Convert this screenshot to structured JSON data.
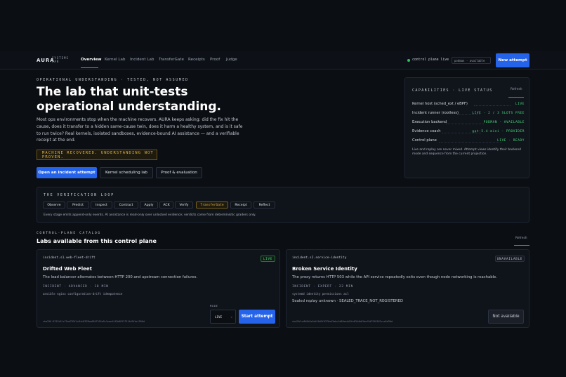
{
  "brand": {
    "name": "AURA",
    "sub": "SYSTEMS LAB"
  },
  "nav": {
    "items": [
      "Overview",
      "Kernel Lab",
      "Incident Lab",
      "TransferGate",
      "Receipts",
      "Proof",
      "Judge"
    ],
    "active": "Overview"
  },
  "status": {
    "text": "control plane live",
    "pill": "podman · available"
  },
  "header_button": "New attempt",
  "hero": {
    "eyebrow": "OPERATIONAL UNDERSTANDING · TESTED, NOT ASSUMED",
    "title": "The lab that unit-tests operational understanding.",
    "body": "Most ops environments stop when the machine recovers. AURA keeps asking: did the fix hit the cause, does it transfer to a hidden same-cause twin, does it harm a healthy system, and is it safe to run twice? Real kernels, isolated sandboxes, evidence-bound AI assistance — and a verifiable receipt at the end.",
    "banner": "MACHINE RECOVERED. UNDERSTANDING NOT PROVEN.",
    "buttons": [
      "Open an incident attempt",
      "Kernel scheduling lab",
      "Proof & evaluation"
    ]
  },
  "capabilities": {
    "title": "CAPABILITIES · LIVE STATUS",
    "refresh": "Refresh",
    "rows": [
      {
        "label": "Kernel host (sched_ext / eBPF)",
        "value": "LIVE"
      },
      {
        "label": "Incident runner (rootless)",
        "value": "LIVE · 2 / 3 SLOTS FREE"
      },
      {
        "label": "Execution backend",
        "value": "PODMAN · AVAILABLE"
      },
      {
        "label": "Evidence coach",
        "value": "gpt-5.4-mini · PROVIDER"
      },
      {
        "label": "Control plane",
        "value": "LIVE · READY"
      }
    ],
    "note": "Live and replay are never mixed. Attempt views identify their backend mode and sequence from the current projection."
  },
  "loop": {
    "title": "THE VERIFICATION LOOP",
    "steps": [
      "Observe",
      "Predict",
      "Inspect",
      "Contract",
      "Apply",
      "ACK",
      "Verify",
      "TransferGate",
      "Receipt",
      "Reflect"
    ],
    "highlight": "TransferGate",
    "note": "Every stage emits append-only events. AI assistance is read-only over unlocked evidence; verdicts come from deterministic graders only."
  },
  "catalog": {
    "eyebrow": "CONTROL-PLANE CATALOG",
    "title": "Labs available from this control plane",
    "refresh": "Refresh",
    "cards": [
      {
        "id": "incident.s1.web-fleet-drift",
        "badge": "LIVE",
        "title": "Drifted Web Fleet",
        "desc": "The load balancer alternates between HTTP 200 and upstream connection failures.",
        "meta": "INCIDENT · ADVANCED · 18 MIN",
        "tags": "ansible  nginx  configuration-drift  idempotence",
        "hash": "sha256:3312b3fc75ad795f4c84c8329ba6847516a9c1eae4f42b88127514d9fbc1990d",
        "mode_label": "MODE",
        "mode_value": "LIVE",
        "action": "Start attempt"
      },
      {
        "id": "incident.s2.service-identity",
        "badge": "UNAVAILABLE",
        "title": "Broken Service Identity",
        "desc": "The proxy returns HTTP 503 while the API service repeatedly exits even though node networking is reachable.",
        "meta": "INCIDENT · EXPERT · 22 MIN",
        "tags": "systemd  identity  permissions  acl",
        "extra": "Sealed replay unknown · SEALED_TRACE_NOT_REGISTERED",
        "hash": "sha256:e8b9b2e5d4f0d9f0370e43ebc1d09ea4d3fe6344b61bef5d7918162cca5d30d",
        "action": "Not available"
      }
    ]
  },
  "colors": {
    "accent": "#2563eb",
    "live": "#4ade80",
    "warning": "#e0b84d"
  }
}
